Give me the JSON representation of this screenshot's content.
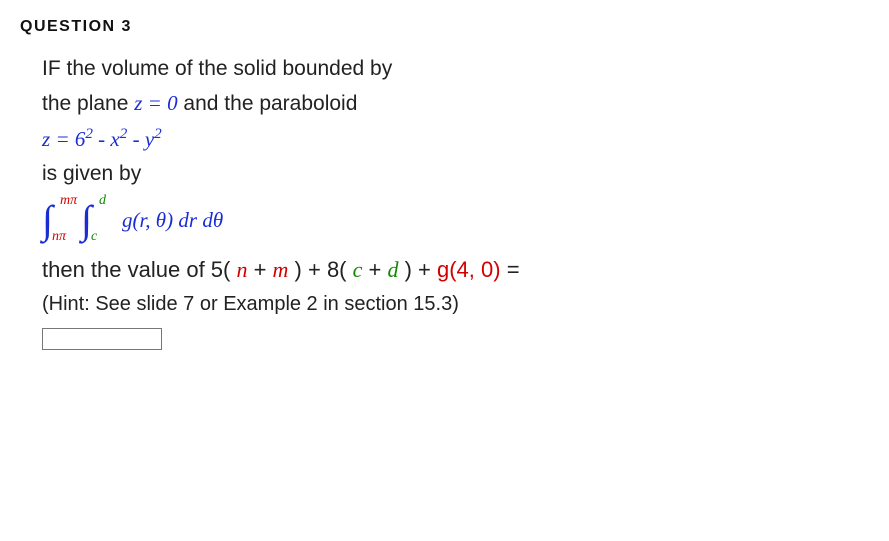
{
  "header": {
    "label": "QUESTION 3"
  },
  "body": {
    "line1": "IF the volume of the solid bounded by",
    "line2_a": "the plane  ",
    "line2_eq": "z = 0",
    "line2_b": "  and the paraboloid",
    "line3_lhs": "z",
    "line3_eq": " = ",
    "line3_6sq": "6",
    "line3_exp1": "2",
    "line3_m1": " - ",
    "line3_x": "x",
    "line3_exp2": "2",
    "line3_m2": " - ",
    "line3_y": "y",
    "line3_exp3": "2",
    "line4": "is given by",
    "integral": {
      "outer_upper": "mπ",
      "outer_lower": "nπ",
      "inner_upper": "d",
      "inner_lower": "c",
      "g": "g",
      "lp": "(",
      "r": "r",
      "comma": ", ",
      "theta": "θ",
      "rp": ")",
      "dr": " dr",
      "dtheta": " dθ"
    },
    "then_a": "then the value of  5( ",
    "then_n": "n",
    "then_p1": " + ",
    "then_m": "m",
    "then_p2": " ) + 8( ",
    "then_c": "c",
    "then_p3": " + ",
    "then_d": "d",
    "then_p4": " ) + ",
    "then_g": "g(4, 0)",
    "then_eq": " =",
    "hint": "(Hint: See slide 7 or  Example 2 in section 15.3)"
  },
  "answer": {
    "value": ""
  }
}
